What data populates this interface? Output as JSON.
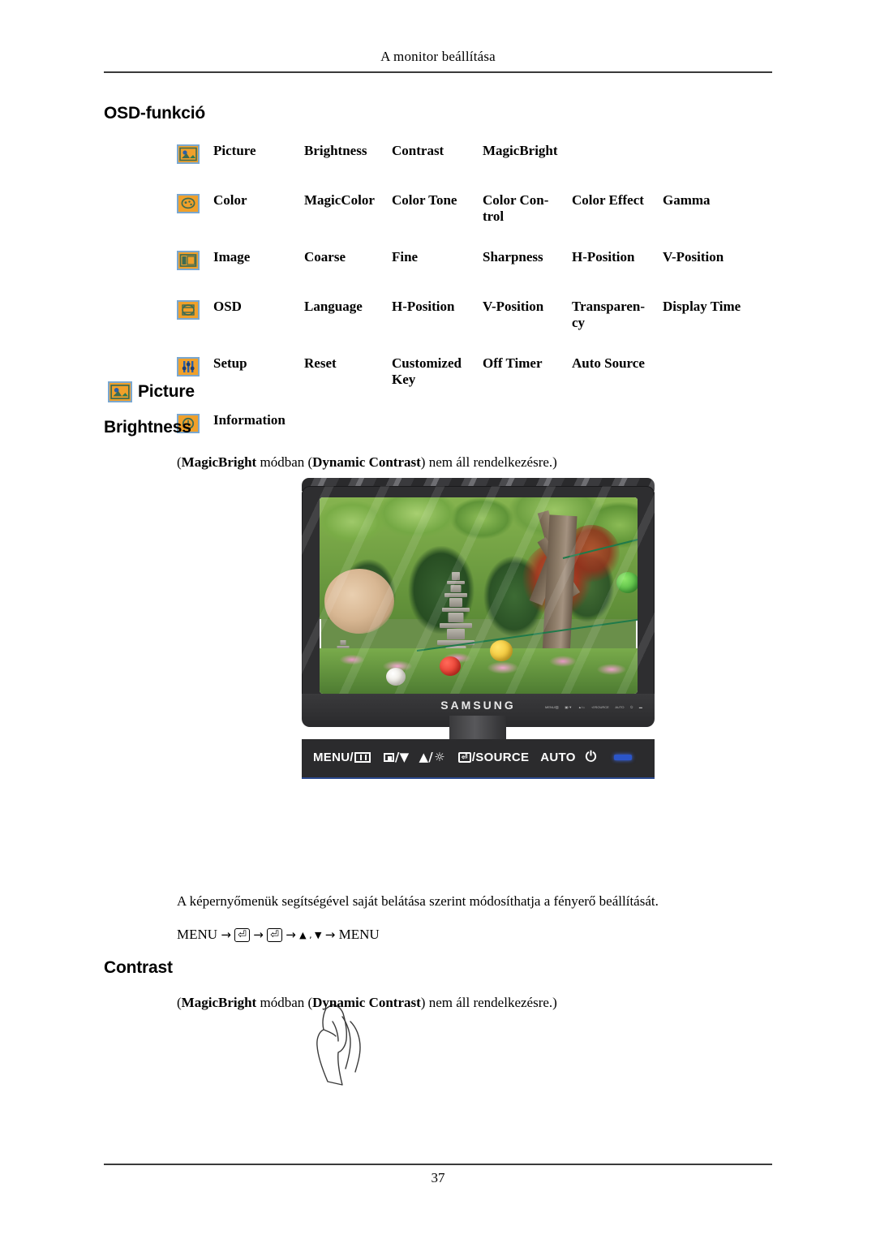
{
  "header": {
    "running_title": "A monitor beállítása"
  },
  "footer": {
    "page_number": "37"
  },
  "sections": {
    "osd_function_title": "OSD-funkció",
    "picture_title": "Picture",
    "brightness_title": "Brightness",
    "contrast_title": "Contrast"
  },
  "osd_table": {
    "rows": [
      {
        "icon": "picture-icon",
        "name": "Picture",
        "items": [
          "Brightness",
          "Contrast",
          "MagicBright",
          "",
          "",
          ""
        ]
      },
      {
        "icon": "color-icon",
        "name": "Color",
        "items": [
          "MagicColor",
          "Color Tone",
          "Color Con-",
          "Color Effect",
          "Gamma",
          ""
        ],
        "wrap": "trol"
      },
      {
        "icon": "image-icon",
        "name": "Image",
        "items": [
          "Coarse",
          "Fine",
          "Sharpness",
          "H-Position",
          "V-Position",
          ""
        ]
      },
      {
        "icon": "osd-icon",
        "name": "OSD",
        "items": [
          "Language",
          "H-Position",
          "V-Position",
          "Transparen-",
          "Display Time",
          ""
        ],
        "wrap": "cy"
      },
      {
        "icon": "setup-icon",
        "name": "Setup",
        "items": [
          "Reset",
          "Customized",
          "Off Timer",
          "Auto Source",
          "",
          ""
        ],
        "wrap": "Key"
      },
      {
        "icon": "information-icon",
        "name": "Information",
        "items": [
          "",
          "",
          "",
          "",
          "",
          ""
        ]
      }
    ]
  },
  "brightness": {
    "note_prefix": "(",
    "note_bold1": "MagicBright",
    "note_mid1": " módban (",
    "note_bold2": "Dynamic Contrast",
    "note_suffix": ") nem áll rendelkezésre.)",
    "description": "A képernyőmenük segítségével saját belátása szerint módosíthatja a fényerő beállítását.",
    "nav_start": "MENU",
    "nav_arrow": "→",
    "nav_key": "⏎",
    "nav_updown": "▲ , ▼",
    "nav_end": "MENU"
  },
  "contrast": {
    "note_prefix": "(",
    "note_bold1": "MagicBright",
    "note_mid1": " módban (",
    "note_bold2": "Dynamic Contrast",
    "note_suffix": ") nem áll rendelkezésre.)"
  },
  "monitor": {
    "brand": "SAMSUNG",
    "controls": [
      {
        "label": "MENU/",
        "glyph": "osd-grid-icon"
      },
      {
        "label": "/",
        "glyph": "source-square-icon",
        "suffix": "▼"
      },
      {
        "label": "/",
        "glyph": "up-triangle-icon",
        "suffix": "☼"
      },
      {
        "label": "/SOURCE",
        "glyph": "enter-icon"
      },
      {
        "label": "AUTO",
        "glyph": ""
      },
      {
        "label": "",
        "glyph": "power-icon"
      }
    ],
    "control_labels": {
      "menu": "MENU/",
      "down": "/▼",
      "up": "▲/",
      "brightness_glyph": "☼",
      "source": "/SOURCE",
      "auto": "AUTO",
      "power": "⏻"
    },
    "led_color": "#2b55c8"
  },
  "colors": {
    "icon_fill": "#f0a02a",
    "icon_border": "#7aa7cf",
    "icon_glyph": "#3d6b52",
    "rule": "#3a3a3a",
    "led": "#2b55c8"
  }
}
